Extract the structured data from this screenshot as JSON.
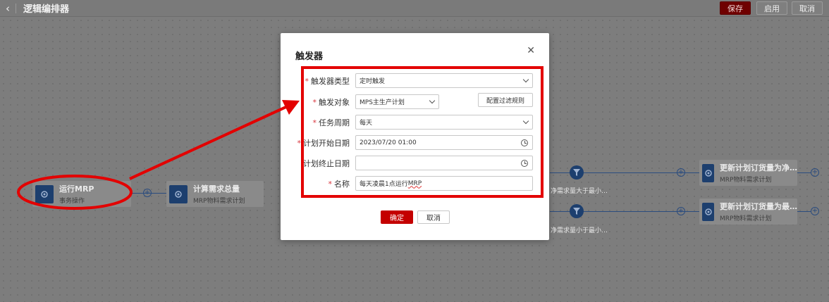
{
  "header": {
    "back_icon": "chevron-left-icon",
    "title": "逻辑编排器",
    "save_label": "保存",
    "enable_label": "启用",
    "cancel_label": "取消"
  },
  "nodes": [
    {
      "title": "运行MRP",
      "subtitle": "事务操作",
      "icon": "gear-icon"
    },
    {
      "title": "计算需求总量",
      "subtitle": "MRP物料需求计划",
      "icon": "gear-icon"
    },
    {
      "title": "更新计划订货量为净…",
      "subtitle": "MRP物料需求计划",
      "icon": "gear-icon"
    },
    {
      "title": "更新计划订货量为最…",
      "subtitle": "MRP物料需求计划",
      "icon": "gear-icon"
    }
  ],
  "filters": [
    {
      "label": "净需求量大于最小…",
      "icon": "filter-icon"
    },
    {
      "label": "净需求量小于最小…",
      "icon": "filter-icon"
    }
  ],
  "dialog": {
    "title": "触发器",
    "close_icon": "close-icon",
    "fields": {
      "trigger_type": {
        "label": "触发器类型",
        "value": "定时触发",
        "required": true
      },
      "trigger_object": {
        "label": "触发对象",
        "value": "MPS主生产计划",
        "required": true,
        "filter_button": "配置过滤规则"
      },
      "task_cycle": {
        "label": "任务周期",
        "value": "每天",
        "required": true
      },
      "start_date": {
        "label": "计划开始日期",
        "value": "2023/07/20 01:00",
        "required": true
      },
      "end_date": {
        "label": "计划终止日期",
        "value": "",
        "required": false
      },
      "name": {
        "label": "名称",
        "value_prefix": "每天凌晨1点运行",
        "value_suffix": "MRP",
        "required": true
      }
    },
    "ok_label": "确定",
    "cancel_label": "取消"
  },
  "colors": {
    "accent": "#c40000",
    "annotation": "#e30000",
    "node_icon": "#1d3f6e"
  }
}
